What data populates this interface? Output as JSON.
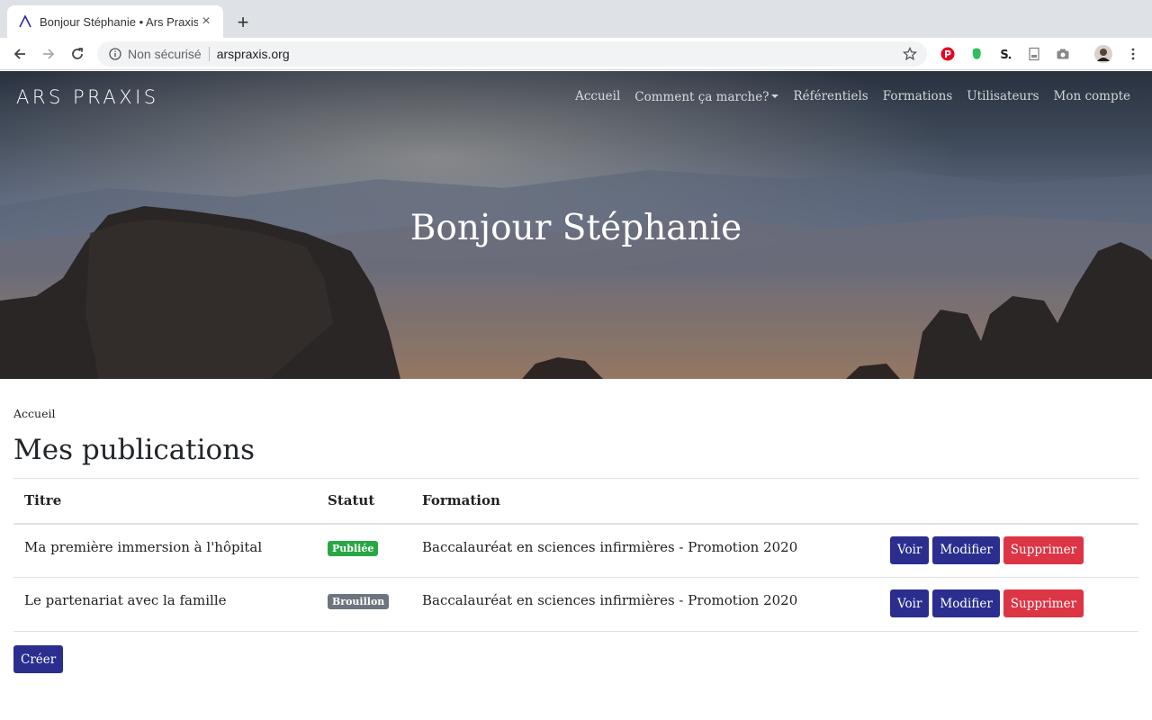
{
  "browser": {
    "tab_title": "Bonjour Stéphanie • Ars Praxis",
    "security_label": "Non sécurisé",
    "url": "arspraxis.org"
  },
  "site": {
    "logo": "ARS PRAXIS",
    "nav": [
      "Accueil",
      "Comment ça marche?",
      "Référentiels",
      "Formations",
      "Utilisateurs",
      "Mon compte"
    ],
    "hero_title": "Bonjour Stéphanie"
  },
  "main": {
    "breadcrumb": "Accueil",
    "title": "Mes publications",
    "table": {
      "headers": [
        "Titre",
        "Statut",
        "Formation",
        ""
      ],
      "rows": [
        {
          "titre": "Ma première immersion à l'hôpital",
          "statut": "Publiée",
          "formation": "Baccalauréat en sciences infirmières - Promotion 2020",
          "actions": [
            "Voir",
            "Modifier",
            "Supprimer"
          ]
        },
        {
          "titre": "Le partenariat avec la famille",
          "statut": "Brouillon",
          "formation": "Baccalauréat en sciences infirmières - Promotion 2020",
          "actions": [
            "Voir",
            "Modifier",
            "Supprimer"
          ]
        }
      ]
    },
    "create_label": "Créer"
  },
  "colors": {
    "primary": "#2b2e8f",
    "danger": "#dc3545",
    "status_published": "#28a745",
    "status_draft": "#6c757d"
  }
}
